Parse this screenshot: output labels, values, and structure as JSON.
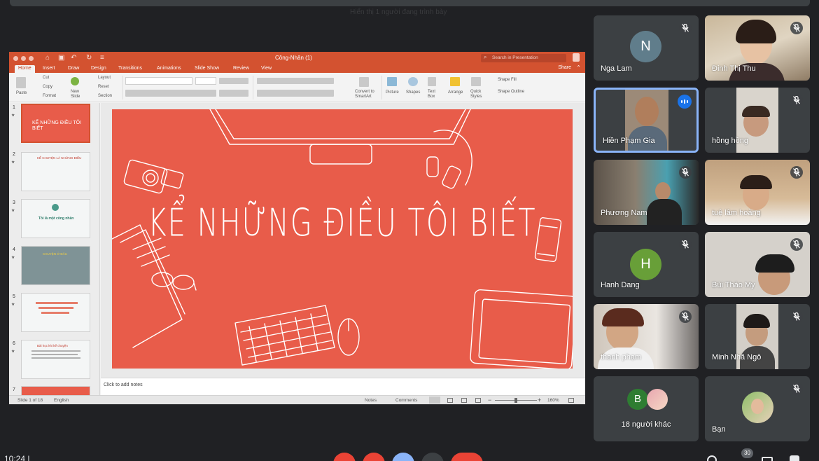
{
  "top": {
    "ghost_text": "Hiển thị 1 người đang trình bày"
  },
  "ppt": {
    "doc_title": "Công-Nhân (1)",
    "search_placeholder": "Search in Presentation",
    "share": "Share",
    "tabs": [
      "Home",
      "Insert",
      "Draw",
      "Design",
      "Transitions",
      "Animations",
      "Slide Show",
      "Review",
      "View"
    ],
    "ribbon": {
      "paste": "Paste",
      "cut": "Cut",
      "copy": "Copy",
      "format": "Format",
      "new_slide": "New\nSlide",
      "layout": "Layout",
      "reset": "Reset",
      "section": "Section",
      "convert": "Convert to\nSmartArt",
      "picture": "Picture",
      "shapes": "Shapes",
      "text_box": "Text\nBox",
      "arrange": "Arrange",
      "quick_styles": "Quick\nStyles",
      "shape_fill": "Shape Fill",
      "shape_outline": "Shape Outline"
    },
    "thumbnails": [
      {
        "num": "1",
        "title": "KỂ NHỮNG ĐIỀU TÔI BIẾT"
      },
      {
        "num": "2",
        "title": "KỂ CHUYỆN LÀ NHỮNG ĐIỀU"
      },
      {
        "num": "3",
        "title": "Tôi là một công nhân"
      },
      {
        "num": "4",
        "title": "CHUYỆN Ở ĐÂU"
      },
      {
        "num": "5",
        "title": ""
      },
      {
        "num": "6",
        "title": "Bài học khi kể chuyện"
      },
      {
        "num": "7",
        "title": ""
      }
    ],
    "slide_title": "KỂ NHỮNG ĐIỀU TÔI BIẾT",
    "notes_placeholder": "Click to add notes",
    "status": {
      "slide_of": "Slide 1 of 18",
      "language": "English",
      "notes": "Notes",
      "comments": "Comments",
      "zoom": "160%"
    }
  },
  "participants": [
    {
      "name": "Nga Lam",
      "initial": "N",
      "avatar_color": "#607d8b",
      "muted": true,
      "type": "avatar"
    },
    {
      "name": "Đinh Thị Thu",
      "muted": true,
      "type": "video"
    },
    {
      "name": "Hiền Phạm Gia",
      "muted": false,
      "speaking": true,
      "type": "video"
    },
    {
      "name": "hồng hồng",
      "muted": true,
      "type": "video"
    },
    {
      "name": "Phương Nam",
      "muted": true,
      "type": "video"
    },
    {
      "name": "tuệ lâm hoàng",
      "muted": true,
      "type": "video"
    },
    {
      "name": "Hanh Dang",
      "initial": "H",
      "avatar_color": "#689f38",
      "muted": true,
      "type": "avatar"
    },
    {
      "name": "Bùi Thảo My",
      "muted": true,
      "type": "video"
    },
    {
      "name": "thanh phạm",
      "muted": true,
      "type": "video"
    },
    {
      "name": "Minh Nhã Ngô",
      "muted": true,
      "type": "video"
    },
    {
      "name": "18 người khác",
      "initial": "B",
      "avatar_color": "#2e7d32",
      "type": "others"
    },
    {
      "name": "Bạn",
      "muted": true,
      "type": "self"
    }
  ],
  "bottom": {
    "clock": "10:24 | ",
    "participants_count": "30"
  },
  "colors": {
    "ppt_accent": "#d35230",
    "slide_bg": "#e85c4a",
    "meet_bg": "#202124",
    "tile_bg": "#3c4043",
    "active_border": "#8ab4f8",
    "end_call": "#ea4335"
  }
}
